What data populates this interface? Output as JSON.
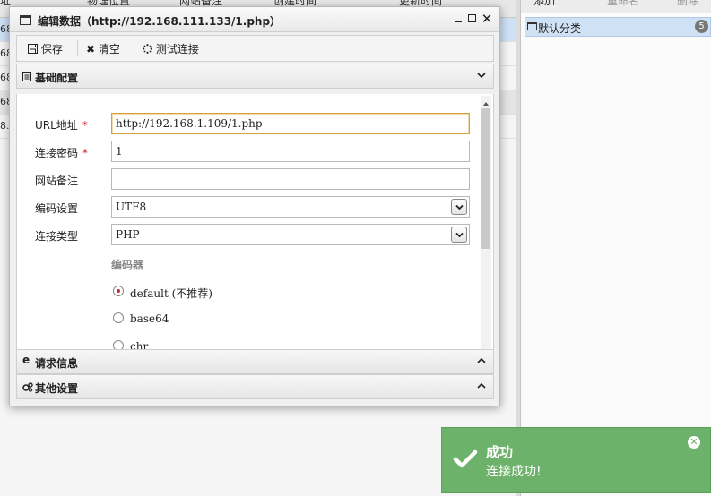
{
  "background": {
    "columns": [
      "址",
      "物理位置",
      "网站备注",
      "创建时间",
      "更新时间"
    ],
    "rows": [
      "68",
      "68",
      "68",
      "68",
      "8."
    ],
    "right_toolbar": [
      "添加",
      "重命名",
      "删除"
    ],
    "category": {
      "label": "默认分类",
      "count": "5"
    }
  },
  "dialog": {
    "title": "编辑数据（http://192.168.111.133/1.php）",
    "toolbar": {
      "save": "保存",
      "clear": "清空",
      "test": "测试连接"
    },
    "sections": {
      "basic": "基础配置",
      "request": "请求信息",
      "other": "其他设置"
    },
    "form": {
      "url_label": "URL地址",
      "url_value": "http://192.168.1.109/1.php",
      "password_label": "连接密码",
      "password_value": "1",
      "note_label": "网站备注",
      "note_value": "",
      "encoding_label": "编码设置",
      "encoding_value": "UTF8",
      "type_label": "连接类型",
      "type_value": "PHP",
      "required_mark": "*",
      "encoder_title": "编码器",
      "encoders": [
        "default (不推荐)",
        "base64",
        "chr"
      ],
      "selected_encoder": "default (不推荐)"
    }
  },
  "toast": {
    "title": "成功",
    "message": "连接成功!",
    "color": "#6db26a"
  }
}
